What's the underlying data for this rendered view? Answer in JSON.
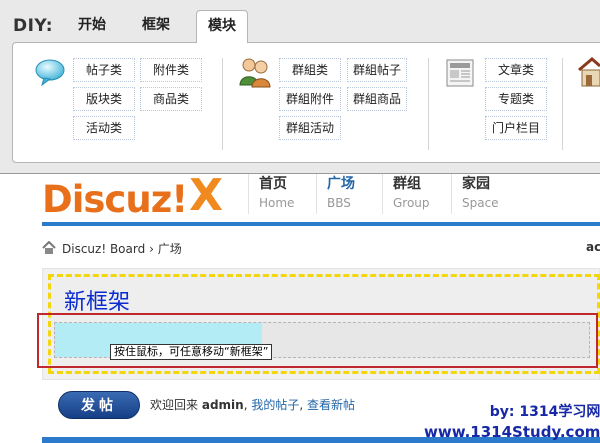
{
  "diy": {
    "label": "DIY:",
    "tabs": [
      {
        "label": "开始"
      },
      {
        "label": "框架"
      },
      {
        "label": "模块"
      }
    ],
    "groups": {
      "thread": {
        "icon": "speech-bubble-icon",
        "items": [
          "帖子类",
          "附件类",
          "版块类",
          "商品类",
          "活动类"
        ]
      },
      "group": {
        "icon": "users-icon",
        "items": [
          "群組类",
          "群組帖子",
          "群組附件",
          "群組商品",
          "群組活动"
        ]
      },
      "portal": {
        "icon": "newspaper-icon",
        "items": [
          "文章类",
          "专题类",
          "门户栏目"
        ]
      },
      "other": {
        "icon": "house-icon"
      }
    }
  },
  "site": {
    "logo": "Discuz!",
    "logo_x": "X",
    "nav": [
      {
        "cn": "首页",
        "en": "Home"
      },
      {
        "cn": "广场",
        "en": "BBS"
      },
      {
        "cn": "群组",
        "en": "Group"
      },
      {
        "cn": "家园",
        "en": "Space"
      }
    ],
    "active_nav": "广场",
    "accent": "#2b7acc"
  },
  "breadcrumb": {
    "board": "Discuz! Board",
    "sep": "›",
    "current": "广场",
    "right": "ac"
  },
  "frame": {
    "title": "新框架",
    "tooltip": "按住鼠标，可任意移动“新框架”"
  },
  "footer": {
    "post_button": "发帖",
    "welcome_prefix": "欢迎回来",
    "username": "admin",
    "comma": ",",
    "my_threads": "我的帖子",
    "view_new": "查看新帖"
  },
  "watermark": {
    "line1": "by:  1314学习网",
    "line2": "www.1314Study.com"
  }
}
